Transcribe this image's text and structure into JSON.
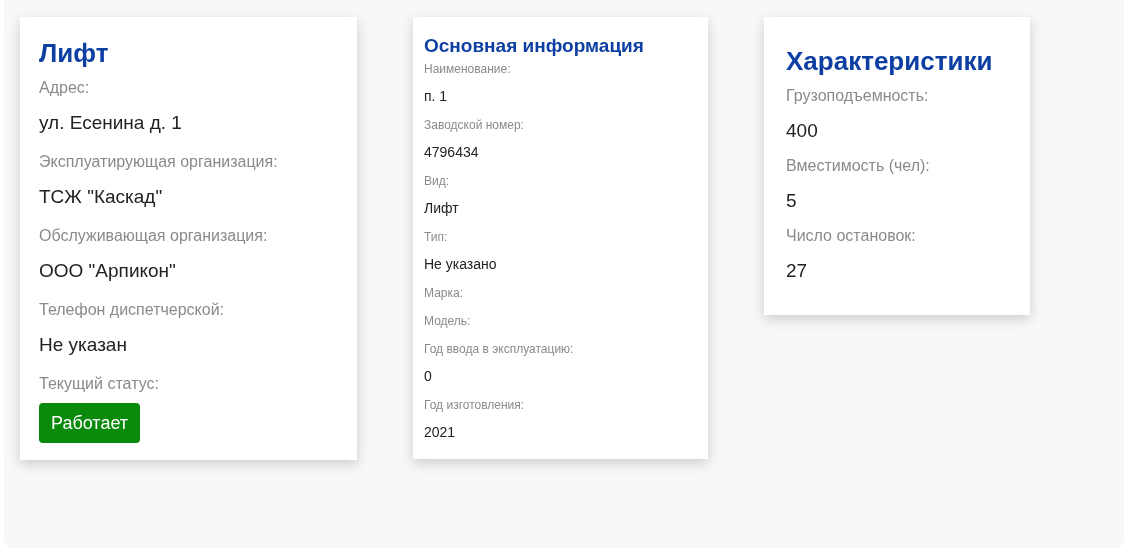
{
  "cards": [
    {
      "kind": "regular",
      "title": "Лифт",
      "fields": [
        {
          "label": "Адрес:",
          "value": "ул. Есенина д. 1"
        },
        {
          "label": "Эксплуатирующая организация:",
          "value": "ТСЖ \"Каскад\""
        },
        {
          "label": "Обслуживающая организация:",
          "value": "ООО \"Арпикон\""
        },
        {
          "label": "Телефон диспетчерской:",
          "value": "Не указан"
        }
      ],
      "status": {
        "label": "Текущий статус:",
        "value": "Работает",
        "kind": "working"
      }
    },
    {
      "kind": "compact",
      "title": "Основная информация",
      "fields": [
        {
          "label": "Наименование:",
          "value": "п. 1"
        },
        {
          "label": "Заводской номер:",
          "value": "4796434"
        },
        {
          "label": "Вид:",
          "value": "Лифт"
        },
        {
          "label": "Тип:",
          "value": "Не указано"
        },
        {
          "label": "Марка:"
        },
        {
          "label": "Модель:"
        },
        {
          "label": "Год ввода в эксплуатацию:",
          "value": "0"
        },
        {
          "label": "Год изготовления:",
          "value": "2021"
        }
      ]
    },
    {
      "kind": "regular",
      "title": "Характеристики",
      "fields": [
        {
          "label": "Грузоподъемность:",
          "value": "400"
        },
        {
          "label": "Вместимость (чел):",
          "value": "5"
        },
        {
          "label": "Число остановок:",
          "value": "27"
        }
      ]
    }
  ]
}
